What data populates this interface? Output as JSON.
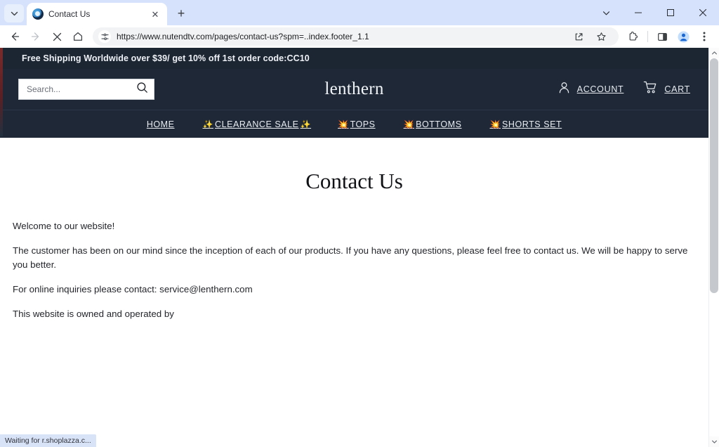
{
  "browser": {
    "tab": {
      "title": "Contact Us",
      "favicon_name": "site-favicon",
      "close_label": "✕"
    },
    "new_tab_label": "+",
    "tab_list_label": "⌄",
    "window_controls": {
      "minimize": "—",
      "maximize": "▢",
      "close": "✕"
    },
    "nav": {
      "back_label": "←",
      "forward_label": "→",
      "stop_label": "✕",
      "home_label": "⌂"
    },
    "omnibox": {
      "url": "https://www.nutendtv.com/pages/contact-us?spm=..index.footer_1.1",
      "site_info_icon": "page-settings-icon",
      "share_icon": "share-icon",
      "bookmark_icon": "star-icon",
      "extensions_icon": "extensions-icon",
      "sidepanel_icon": "side-panel-icon",
      "profile_icon": "profile-avatar-icon",
      "menu_icon": "three-dot-menu-icon"
    },
    "status_text": "Waiting for r.shoplazza.c..."
  },
  "site": {
    "announcement": "Free Shipping Worldwide over $39/ get 10% off 1st order code:CC10",
    "search": {
      "placeholder": "Search...",
      "value": "",
      "icon": "search-icon"
    },
    "brand": "lenthern",
    "account": {
      "label": "ACCOUNT",
      "icon": "user-icon"
    },
    "cart": {
      "label": "CART",
      "icon": "cart-icon"
    },
    "nav_items": [
      {
        "label": "HOME",
        "emoji_before": "",
        "emoji_after": ""
      },
      {
        "label": "CLEARANCE SALE",
        "emoji_before": "✨",
        "emoji_after": "✨"
      },
      {
        "label": "TOPS",
        "emoji_before": "💥",
        "emoji_after": ""
      },
      {
        "label": "BOTTOMS",
        "emoji_before": "💥",
        "emoji_after": ""
      },
      {
        "label": "SHORTS SET",
        "emoji_before": "💥",
        "emoji_after": ""
      }
    ]
  },
  "main": {
    "title": "Contact Us",
    "paragraphs": [
      "Welcome to our website!",
      "The customer has been on our mind since the inception of each of our products. If you have any questions, please feel free to contact us. We will be happy to serve you better.",
      "For online inquiries please contact: service@lenthern.com",
      "This website is owned and operated by"
    ]
  },
  "colors": {
    "site_dark": "#1e2836",
    "announce_dark": "#1c2633",
    "tabstrip": "#d6e2fb",
    "status_bg": "#d9e3f7"
  }
}
